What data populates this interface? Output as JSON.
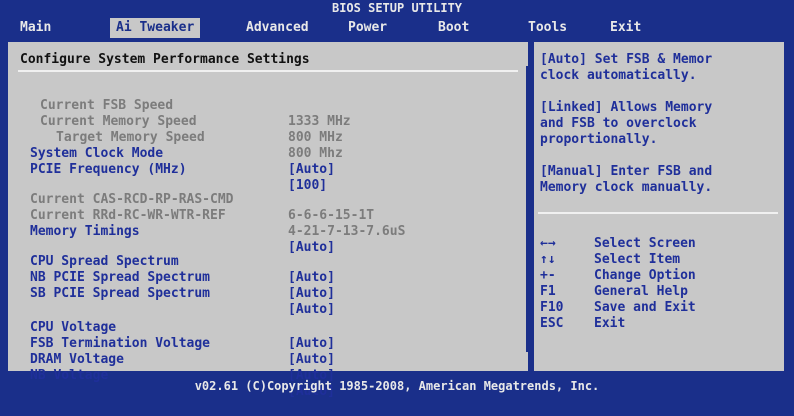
{
  "title": "BIOS SETUP UTILITY",
  "menu": [
    "Main",
    "Ai Tweaker",
    "Advanced",
    "Power",
    "Boot",
    "Tools",
    "Exit"
  ],
  "section_title": "Configure System Performance Settings",
  "rows": [
    {
      "label": "Current FSB Speed",
      "value": "1333 MHz"
    },
    {
      "label": "Current Memory Speed",
      "value": "800 MHz"
    },
    {
      "label": "Target Memory Speed",
      "value": "800 Mhz"
    },
    {
      "label": "System Clock Mode",
      "value": "[Auto]"
    },
    {
      "label": "PCIE Frequency (MHz)",
      "value": "[100]"
    },
    {
      "label": "Current CAS-RCD-RP-RAS-CMD",
      "value": "6-6-6-15-1T"
    },
    {
      "label": "Current RRd-RC-WR-WTR-REF",
      "value": "4-21-7-13-7.6uS"
    },
    {
      "label": "Memory Timings",
      "value": "[Auto]"
    },
    {
      "label": "CPU Spread Spectrum",
      "value": "[Auto]"
    },
    {
      "label": "NB PCIE Spread Spectrum",
      "value": "[Auto]"
    },
    {
      "label": "SB PCIE Spread Spectrum",
      "value": "[Auto]"
    },
    {
      "label": "CPU Voltage",
      "value": "[Auto]"
    },
    {
      "label": "FSB Termination Voltage",
      "value": "[Auto]"
    },
    {
      "label": "DRAM Voltage",
      "value": "[Auto]"
    },
    {
      "label": "NB Voltage",
      "value": "[Auto]"
    }
  ],
  "help": [
    [
      "[Auto] Set FSB & Memor",
      "clock automatically."
    ],
    [
      "[Linked] Allows Memory",
      "and FSB to overclock",
      "proportionally."
    ],
    [
      "[Manual] Enter FSB and",
      "Memory clock manually."
    ]
  ],
  "keys": [
    {
      "key": "←→",
      "desc": "Select Screen"
    },
    {
      "key": "↑↓",
      "desc": "Select Item"
    },
    {
      "key": "+-",
      "desc": "Change Option"
    },
    {
      "key": "F1",
      "desc": "General Help"
    },
    {
      "key": "F10",
      "desc": "Save and Exit"
    },
    {
      "key": "ESC",
      "desc": "Exit"
    }
  ],
  "footer": "v02.61 (C)Copyright 1985-2008, American Megatrends, Inc."
}
